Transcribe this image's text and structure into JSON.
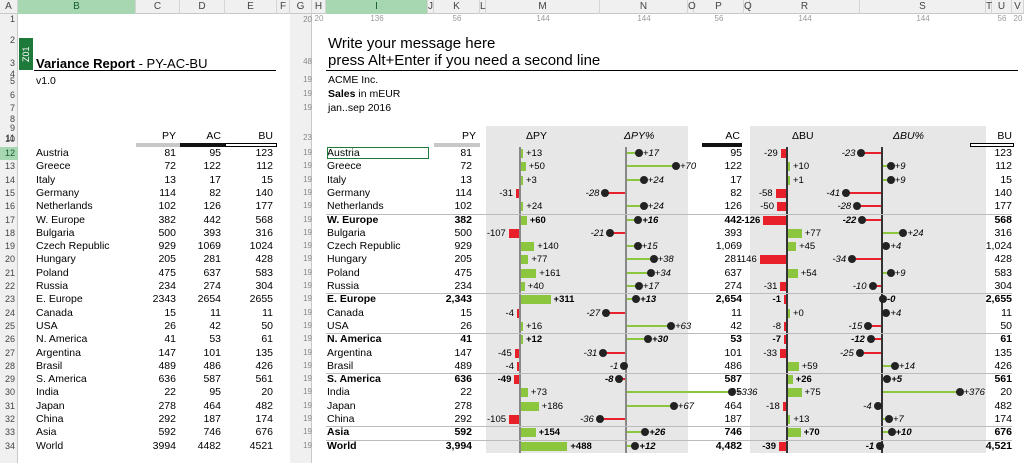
{
  "columns_left": [
    "A",
    "B",
    "C",
    "D",
    "E",
    "F",
    "G"
  ],
  "columns_right": [
    "H",
    "I",
    "J",
    "K",
    "L",
    "M",
    "N",
    "O",
    "P",
    "Q",
    "R",
    "S",
    "T",
    "U",
    "V"
  ],
  "col_widths_right": {
    "H": "20",
    "I": "136",
    "K": "56",
    "M": "144",
    "N": "144",
    "P": "56",
    "R": "144",
    "S": "144",
    "U": "56",
    "V": "20"
  },
  "rows": [
    "1",
    "2",
    "3",
    "4",
    "5",
    "6",
    "7",
    "8",
    "9",
    "10",
    "11",
    "12",
    "13",
    "14",
    "15",
    "16",
    "17",
    "18",
    "19",
    "20",
    "21",
    "22",
    "23",
    "24",
    "25",
    "26",
    "27",
    "28",
    "29",
    "30",
    "31",
    "32",
    "33",
    "34"
  ],
  "row_heights": {
    "1": "20",
    "2": "",
    "3": "48",
    "5": "19",
    "6": "19",
    "7": "19",
    "8": "",
    "9": "",
    "10": "23",
    "11": ""
  },
  "data_row_height": "19",
  "badge": "Z01",
  "left": {
    "title_bold": "Variance Report",
    "title_rest": " - PY-AC-BU",
    "version": "v1.0",
    "headers": [
      "PY",
      "AC",
      "BU"
    ],
    "rows": [
      [
        "Austria",
        "81",
        "95",
        "123"
      ],
      [
        "Greece",
        "72",
        "122",
        "112"
      ],
      [
        "Italy",
        "13",
        "17",
        "15"
      ],
      [
        "Germany",
        "114",
        "82",
        "140"
      ],
      [
        "Netherlands",
        "102",
        "126",
        "177"
      ],
      [
        "W. Europe",
        "382",
        "442",
        "568"
      ],
      [
        "Bulgaria",
        "500",
        "393",
        "316"
      ],
      [
        "Czech Republic",
        "929",
        "1069",
        "1024"
      ],
      [
        "Hungary",
        "205",
        "281",
        "428"
      ],
      [
        "Poland",
        "475",
        "637",
        "583"
      ],
      [
        "Russia",
        "234",
        "274",
        "304"
      ],
      [
        "E. Europe",
        "2343",
        "2654",
        "2655"
      ],
      [
        "Canada",
        "15",
        "11",
        "11"
      ],
      [
        "USA",
        "26",
        "42",
        "50"
      ],
      [
        "N. America",
        "41",
        "53",
        "61"
      ],
      [
        "Argentina",
        "147",
        "101",
        "135"
      ],
      [
        "Brasil",
        "489",
        "486",
        "426"
      ],
      [
        "S. America",
        "636",
        "587",
        "561"
      ],
      [
        "India",
        "22",
        "95",
        "20"
      ],
      [
        "Japan",
        "278",
        "464",
        "482"
      ],
      [
        "China",
        "292",
        "187",
        "174"
      ],
      [
        "Asia",
        "592",
        "746",
        "676"
      ],
      [
        "World",
        "3994",
        "4482",
        "4521"
      ]
    ]
  },
  "right": {
    "message1": "Write your message here",
    "message2": "press Alt+Enter if you need a second line",
    "company": "ACME Inc.",
    "measure_bold": "Sales",
    "measure_rest": " in mEUR",
    "period": "jan..sep 2016",
    "headers": {
      "py": "PY",
      "dpy": "ΔPY",
      "dpyp": "ΔPY%",
      "ac": "AC",
      "dbu": "ΔBU",
      "dbup": "ΔBU%",
      "bu": "BU"
    },
    "rows": [
      {
        "n": "Austria",
        "py": "81",
        "dpy": 13,
        "dpyl": "+13",
        "pp": 17,
        "ppl": "+17",
        "ac": "95",
        "db": -29,
        "dbl": "-29",
        "bp": -23,
        "bpl": "-23",
        "bu": "123"
      },
      {
        "n": "Greece",
        "py": "72",
        "dpy": 50,
        "dpyl": "+50",
        "pp": 70,
        "ppl": "+70",
        "ac": "122",
        "db": 10,
        "dbl": "+10",
        "bp": 9,
        "bpl": "+9",
        "bu": "112"
      },
      {
        "n": "Italy",
        "py": "13",
        "dpy": 3,
        "dpyl": "+3",
        "pp": 24,
        "ppl": "+24",
        "ac": "17",
        "db": 1,
        "dbl": "+1",
        "bp": 9,
        "bpl": "+9",
        "bu": "15"
      },
      {
        "n": "Germany",
        "py": "114",
        "dpy": -31,
        "dpyl": "-31",
        "pp": -28,
        "ppl": "-28",
        "ac": "82",
        "db": -58,
        "dbl": "-58",
        "bp": -41,
        "bpl": "-41",
        "bu": "140"
      },
      {
        "n": "Netherlands",
        "py": "102",
        "dpy": 24,
        "dpyl": "+24",
        "pp": 24,
        "ppl": "+24",
        "ac": "126",
        "db": -50,
        "dbl": "-50",
        "bp": -28,
        "bpl": "-28",
        "bu": "177"
      },
      {
        "n": "W. Europe",
        "py": "382",
        "dpy": 60,
        "dpyl": "+60",
        "pp": 16,
        "ppl": "+16",
        "ac": "442",
        "db": -126,
        "dbl": "-126",
        "bp": -22,
        "bpl": "-22",
        "bu": "568",
        "b": true
      },
      {
        "n": "Bulgaria",
        "py": "500",
        "dpy": -107,
        "dpyl": "-107",
        "pp": -21,
        "ppl": "-21",
        "ac": "393",
        "db": 77,
        "dbl": "+77",
        "bp": 24,
        "bpl": "+24",
        "bu": "316"
      },
      {
        "n": "Czech Republic",
        "py": "929",
        "dpy": 140,
        "dpyl": "+140",
        "pp": 15,
        "ppl": "+15",
        "ac": "1,069",
        "db": 45,
        "dbl": "+45",
        "bp": 4,
        "bpl": "+4",
        "bu": "1,024"
      },
      {
        "n": "Hungary",
        "py": "205",
        "dpy": 77,
        "dpyl": "+77",
        "pp": 38,
        "ppl": "+38",
        "ac": "281",
        "db": -146,
        "dbl": "-146",
        "bp": -34,
        "bpl": "-34",
        "bu": "428"
      },
      {
        "n": "Poland",
        "py": "475",
        "dpy": 161,
        "dpyl": "+161",
        "pp": 34,
        "ppl": "+34",
        "ac": "637",
        "db": 54,
        "dbl": "+54",
        "bp": 9,
        "bpl": "+9",
        "bu": "583"
      },
      {
        "n": "Russia",
        "py": "234",
        "dpy": 40,
        "dpyl": "+40",
        "pp": 17,
        "ppl": "+17",
        "ac": "274",
        "db": -31,
        "dbl": "-31",
        "bp": -10,
        "bpl": "-10",
        "bu": "304"
      },
      {
        "n": "E. Europe",
        "py": "2,343",
        "dpy": 311,
        "dpyl": "+311",
        "pp": 13,
        "ppl": "+13",
        "ac": "2,654",
        "db": -1,
        "dbl": "-1",
        "bp": 0,
        "bpl": "-0",
        "bu": "2,655",
        "b": true
      },
      {
        "n": "Canada",
        "py": "15",
        "dpy": -4,
        "dpyl": "-4",
        "pp": -27,
        "ppl": "-27",
        "ac": "11",
        "db": 0,
        "dbl": "+0",
        "bp": 4,
        "bpl": "+4",
        "bu": "11"
      },
      {
        "n": "USA",
        "py": "26",
        "dpy": 16,
        "dpyl": "+16",
        "pp": 63,
        "ppl": "+63",
        "ac": "42",
        "db": -8,
        "dbl": "-8",
        "bp": -15,
        "bpl": "-15",
        "bu": "50"
      },
      {
        "n": "N. America",
        "py": "41",
        "dpy": 12,
        "dpyl": "+12",
        "pp": 30,
        "ppl": "+30",
        "ac": "53",
        "db": -7,
        "dbl": "-7",
        "bp": -12,
        "bpl": "-12",
        "bu": "61",
        "b": true
      },
      {
        "n": "Argentina",
        "py": "147",
        "dpy": -45,
        "dpyl": "-45",
        "pp": -31,
        "ppl": "-31",
        "ac": "101",
        "db": -33,
        "dbl": "-33",
        "bp": -25,
        "bpl": "-25",
        "bu": "135"
      },
      {
        "n": "Brasil",
        "py": "489",
        "dpy": -4,
        "dpyl": "-4",
        "pp": -1,
        "ppl": "-1",
        "ac": "486",
        "db": 59,
        "dbl": "+59",
        "bp": 14,
        "bpl": "+14",
        "bu": "426"
      },
      {
        "n": "S. America",
        "py": "636",
        "dpy": -49,
        "dpyl": "-49",
        "pp": -8,
        "ppl": "-8",
        "ac": "587",
        "db": 26,
        "dbl": "+26",
        "bp": 5,
        "bpl": "+5",
        "bu": "561",
        "b": true
      },
      {
        "n": "India",
        "py": "22",
        "dpy": 73,
        "dpyl": "+73",
        "pp": 336,
        "ppl": "+336",
        "ac": "95",
        "db": 75,
        "dbl": "+75",
        "bp": 376,
        "bpl": "+376",
        "bu": "20"
      },
      {
        "n": "Japan",
        "py": "278",
        "dpy": 186,
        "dpyl": "+186",
        "pp": 67,
        "ppl": "+67",
        "ac": "464",
        "db": -18,
        "dbl": "-18",
        "bp": -4,
        "bpl": "-4",
        "bu": "482"
      },
      {
        "n": "China",
        "py": "292",
        "dpy": -105,
        "dpyl": "-105",
        "pp": -36,
        "ppl": "-36",
        "ac": "187",
        "db": 13,
        "dbl": "+13",
        "bp": 7,
        "bpl": "+7",
        "bu": "174"
      },
      {
        "n": "Asia",
        "py": "592",
        "dpy": 154,
        "dpyl": "+154",
        "pp": 26,
        "ppl": "+26",
        "ac": "746",
        "db": 70,
        "dbl": "+70",
        "bp": 10,
        "bpl": "+10",
        "bu": "676",
        "b": true
      },
      {
        "n": "World",
        "py": "3,994",
        "dpy": 488,
        "dpyl": "+488",
        "pp": 12,
        "ppl": "+12",
        "ac": "4,482",
        "db": -39,
        "dbl": "-39",
        "bp": -1,
        "bpl": "-1",
        "bu": "4,521",
        "b": true
      }
    ]
  },
  "colors": {
    "pos": "#8cc63f",
    "neg": "#e8202a",
    "band": "#e7e7e7",
    "selected": "#a7d7b1",
    "badge": "#1d7a3a"
  }
}
